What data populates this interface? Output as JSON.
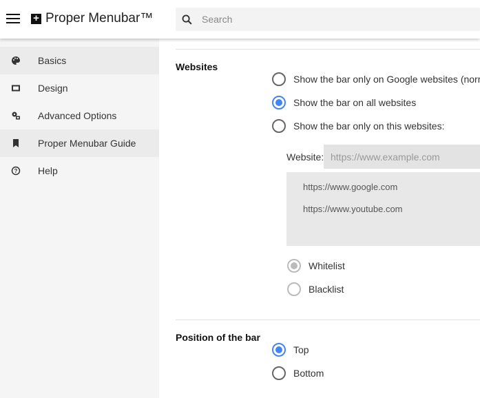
{
  "header": {
    "title": "Proper Menubar™",
    "logo": "+",
    "search_placeholder": "Search"
  },
  "sidebar": {
    "items": [
      {
        "label": "Basics",
        "icon": "palette-icon",
        "selected": true
      },
      {
        "label": "Design",
        "icon": "window-icon",
        "selected": false
      },
      {
        "label": "Advanced Options",
        "icon": "settings-icon",
        "selected": false
      },
      {
        "label": "Proper Menubar Guide",
        "icon": "bookmark-icon",
        "selected": true
      },
      {
        "label": "Help",
        "icon": "help-icon",
        "selected": false
      }
    ]
  },
  "websites": {
    "title": "Websites",
    "options": [
      "Show the bar only on Google websites (normal",
      "Show the bar on all websites",
      "Show the bar only on this websites:"
    ],
    "selected": 1,
    "website_label": "Website:",
    "website_placeholder": "https://www.example.com",
    "list": [
      "https://www.google.com",
      "https://www.youtube.com"
    ],
    "mode_options": [
      "Whitelist",
      "Blacklist"
    ],
    "mode_selected": 0
  },
  "position": {
    "title": "Position of the bar",
    "options": [
      "Top",
      "Bottom"
    ],
    "selected": 0
  },
  "colors": {
    "accent": "#4285f4",
    "sidebar_bg": "#f5f5f5"
  }
}
